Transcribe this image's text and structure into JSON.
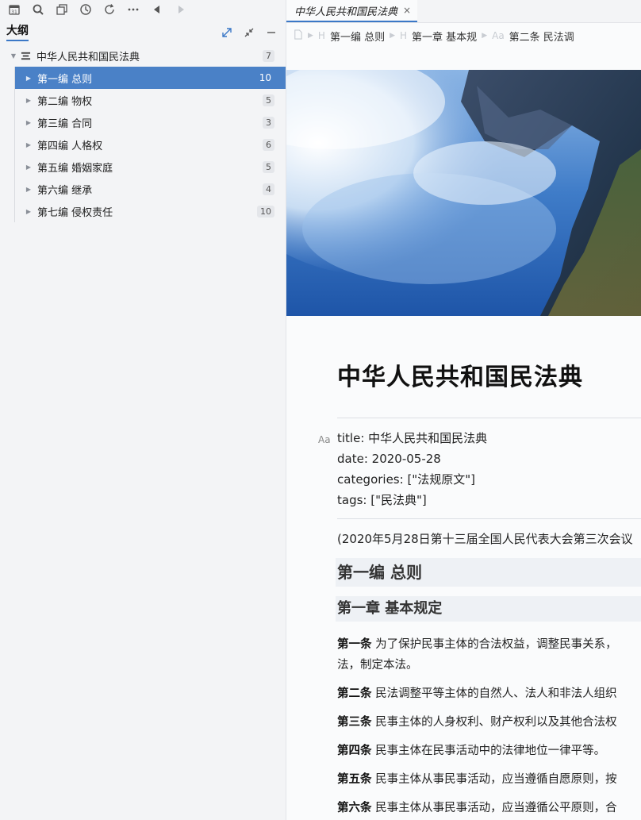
{
  "left_panel": {
    "title": "大纲",
    "outline": {
      "root": {
        "label": "中华人民共和国民法典",
        "count": "7"
      },
      "items": [
        {
          "label": "第一编 总则",
          "count": "10"
        },
        {
          "label": "第二编 物权",
          "count": "5"
        },
        {
          "label": "第三编 合同",
          "count": "3"
        },
        {
          "label": "第四编 人格权",
          "count": "6"
        },
        {
          "label": "第五编 婚姻家庭",
          "count": "5"
        },
        {
          "label": "第六编 继承",
          "count": "4"
        },
        {
          "label": "第七编 侵权责任",
          "count": "10"
        }
      ]
    }
  },
  "editor": {
    "tab": {
      "label": "中华人民共和国民法典",
      "close": "×"
    },
    "breadcrumb": {
      "item1": "第一编 总则",
      "item2": "第一章 基本规",
      "item3": "第二条 民法调",
      "h_marker": "H",
      "aa_marker": "Aa"
    },
    "doc_title": "中华人民共和国民法典",
    "frontmatter_icon": "Aa",
    "frontmatter": {
      "title": "title: 中华人民共和国民法典",
      "date": "date: 2020-05-28",
      "categories": "categories: [\"法规原文\"]",
      "tags": "tags: [\"民法典\"]"
    },
    "note": "(2020年5月28日第十三届全国人民代表大会第三次会议",
    "heading1": "第一编 总则",
    "heading2": "第一章 基本规定",
    "articles": [
      {
        "num": "第一条",
        "text": " 为了保护民事主体的合法权益，调整民事关系，",
        "cont": "法，制定本法。"
      },
      {
        "num": "第二条",
        "text": " 民法调整平等主体的自然人、法人和非法人组织"
      },
      {
        "num": "第三条",
        "text": " 民事主体的人身权利、财产权利以及其他合法权"
      },
      {
        "num": "第四条",
        "text": " 民事主体在民事活动中的法律地位一律平等。"
      },
      {
        "num": "第五条",
        "text": " 民事主体从事民事活动，应当遵循自愿原则，按"
      },
      {
        "num": "第六条",
        "text": " 民事主体从事民事活动，应当遵循公平原则，合"
      }
    ]
  },
  "colors": {
    "accent": "#3b78c7",
    "selected_row": "#4a81c7"
  }
}
